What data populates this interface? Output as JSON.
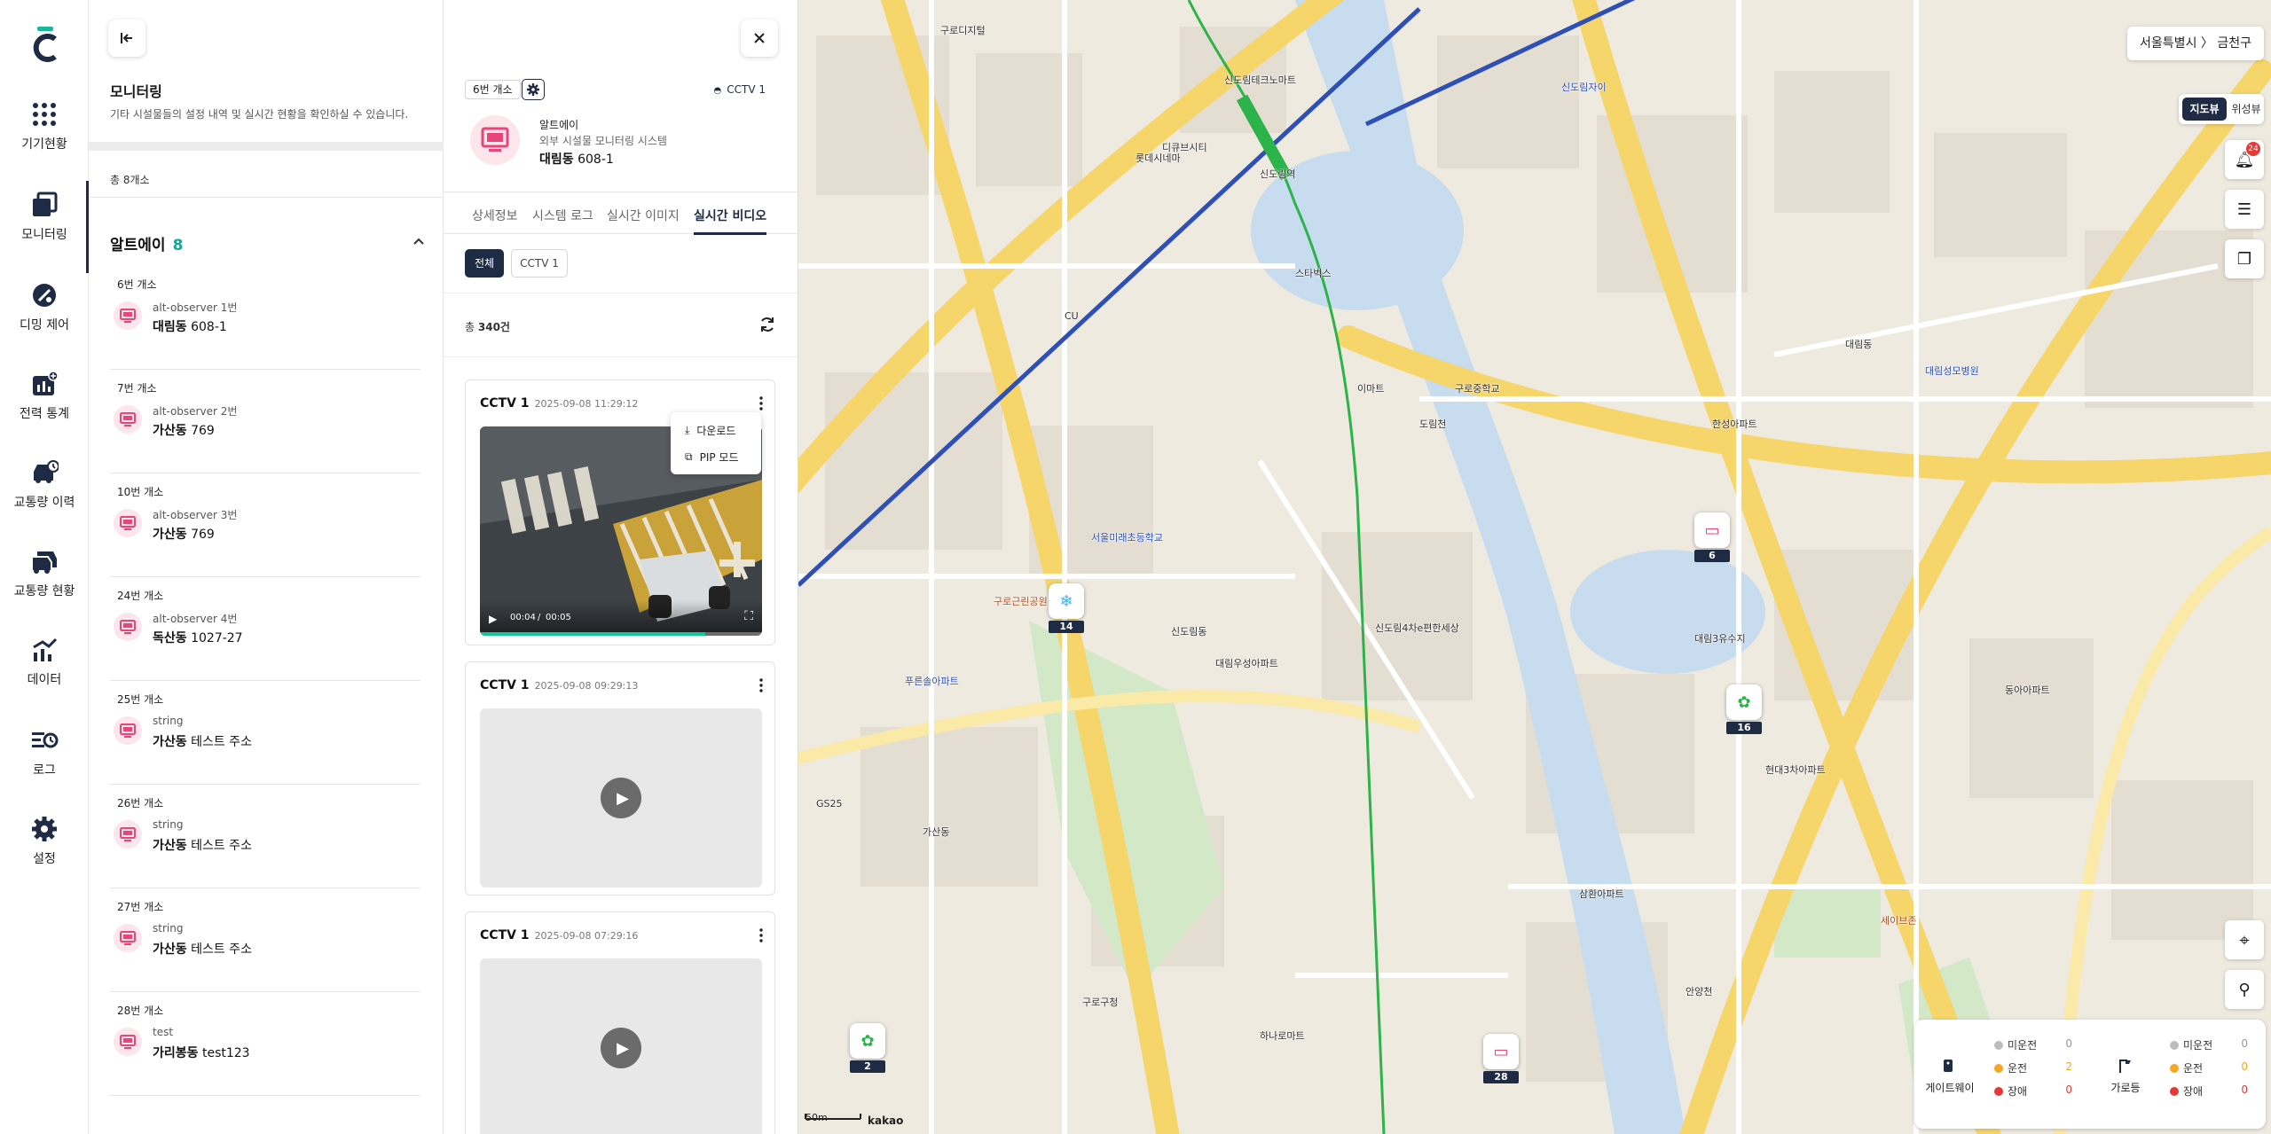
{
  "nav": {
    "items": [
      {
        "label": "기기현황",
        "icon": "grid-icon"
      },
      {
        "label": "모니터링",
        "icon": "monitoring-icon"
      },
      {
        "label": "디밍 제어",
        "icon": "dimming-icon"
      },
      {
        "label": "전력 통계",
        "icon": "power-stats-icon"
      },
      {
        "label": "교통량 이력",
        "icon": "traffic-history-icon"
      },
      {
        "label": "교통량 현황",
        "icon": "traffic-status-icon"
      },
      {
        "label": "데이터",
        "icon": "data-chart-icon"
      },
      {
        "label": "로그",
        "icon": "log-icon"
      },
      {
        "label": "설정",
        "icon": "settings-icon"
      }
    ],
    "active": "모니터링"
  },
  "list_panel": {
    "title": "모니터링",
    "subtitle": "기타 시설물들의 설정 내역 및 실시간 현황을 확인하실 수 있습니다.",
    "total": "총 8개소",
    "group": {
      "name": "알트에이",
      "count": "8"
    },
    "devices": [
      {
        "post": "6번 개소",
        "observer": "alt-observer 1번",
        "district": "대림동",
        "address": "608-1"
      },
      {
        "post": "7번 개소",
        "observer": "alt-observer 2번",
        "district": "가산동",
        "address": "769"
      },
      {
        "post": "10번 개소",
        "observer": "alt-observer 3번",
        "district": "가산동",
        "address": "769"
      },
      {
        "post": "24번 개소",
        "observer": "alt-observer 4번",
        "district": "독산동",
        "address": "1027-27"
      },
      {
        "post": "25번 개소",
        "observer": "string",
        "district": "가산동",
        "address": "테스트 주소"
      },
      {
        "post": "26번 개소",
        "observer": "string",
        "district": "가산동",
        "address": "테스트 주소"
      },
      {
        "post": "27번 개소",
        "observer": "string",
        "district": "가산동",
        "address": "테스트 주소"
      },
      {
        "post": "28번 개소",
        "observer": "test",
        "district": "가리봉동",
        "address": "test123"
      }
    ]
  },
  "detail": {
    "post": "6번 개소",
    "cctv": "CCTV 1",
    "name": "알트에이",
    "desc": "외부 시설물 모니터링 시스템",
    "district": "대림동",
    "address": "608-1",
    "tabs": [
      "상세정보",
      "시스템 로그",
      "실시간 이미지",
      "실시간 비디오"
    ],
    "active_tab": "실시간 비디오",
    "filters": [
      "전체",
      "CCTV 1"
    ],
    "total_label": "총",
    "total_value": "340건",
    "videos": [
      {
        "camera": "CCTV 1",
        "time": "2025-09-08 11:29:12",
        "current": "00:04",
        "duration": "00:05",
        "progress": 0.8
      },
      {
        "camera": "CCTV 1",
        "time": "2025-09-08 09:29:13"
      },
      {
        "camera": "CCTV 1",
        "time": "2025-09-08 07:29:16"
      }
    ],
    "menu": {
      "download": "다운로드",
      "pip": "PIP 모드"
    }
  },
  "map": {
    "region": "서울특별시 〉 금천구",
    "view_map": "지도뷰",
    "view_sat": "위성뷰",
    "notif_count": "24",
    "scale": "50m",
    "provider": "kakao",
    "markers": [
      {
        "count": "14",
        "kind": "snow"
      },
      {
        "count": "6",
        "kind": "monitor"
      },
      {
        "count": "16",
        "kind": "plant"
      },
      {
        "count": "2",
        "kind": "plant"
      },
      {
        "count": "28",
        "kind": "monitor"
      }
    ],
    "legend": [
      {
        "name": "게이트웨이",
        "rows": [
          {
            "label": "미운전",
            "value": "0",
            "color": "#bdbdbd"
          },
          {
            "label": "운전",
            "value": "2",
            "color": "#f5a623"
          },
          {
            "label": "장애",
            "value": "0",
            "color": "#e53935"
          }
        ]
      },
      {
        "name": "가로등",
        "rows": [
          {
            "label": "미운전",
            "value": "0",
            "color": "#bdbdbd"
          },
          {
            "label": "운전",
            "value": "0",
            "color": "#f5a623"
          },
          {
            "label": "장애",
            "value": "0",
            "color": "#e53935"
          }
        ]
      }
    ],
    "places": [
      "신도림역",
      "디큐브시티",
      "대림3유수지",
      "구로근린공원",
      "신도림테크노마트",
      "서울미래초등학교",
      "가산동",
      "신도림동",
      "대림동",
      "구로구청",
      "도림천",
      "안양천",
      "신도림자이",
      "한성아파트",
      "구로디지털",
      "GS25",
      "CU",
      "이마트",
      "롯데시네마",
      "대림성모병원",
      "스타벅스",
      "세이브존",
      "현대3차아파트",
      "신도림4차e편한세상",
      "구로중학교",
      "동아아파트",
      "푸른솔아파트",
      "하나로마트",
      "대림우성아파트",
      "삼환아파트"
    ]
  }
}
